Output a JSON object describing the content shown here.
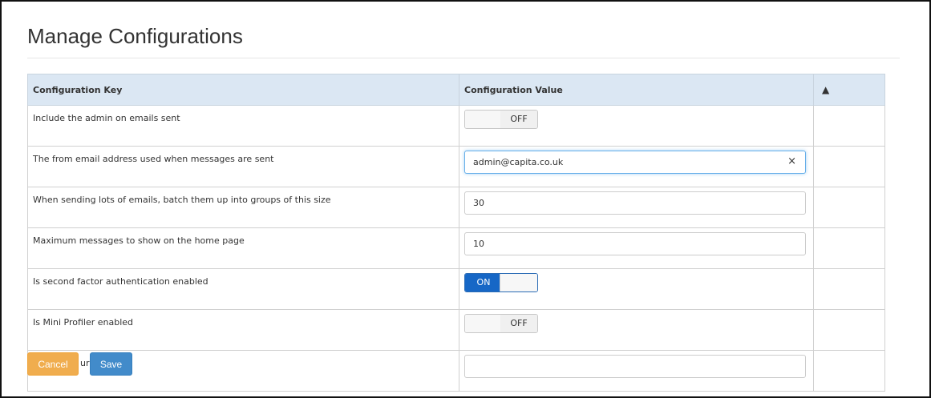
{
  "page": {
    "title": "Manage Configurations"
  },
  "table": {
    "headers": {
      "key": "Configuration Key",
      "value": "Configuration Value",
      "warning_icon": "warning-triangle-icon"
    },
    "rows": [
      {
        "key": "Include the admin on emails sent",
        "type": "toggle",
        "state": "OFF"
      },
      {
        "key": "The from email address used when messages are sent",
        "type": "text",
        "value": "admin@capita.co.uk",
        "clear_icon": "×"
      },
      {
        "key": "When sending lots of emails, batch them up into groups of this size",
        "type": "text",
        "value": "30"
      },
      {
        "key": "Maximum messages to show on the home page",
        "type": "text",
        "value": "10"
      },
      {
        "key": "Is second factor authentication enabled",
        "type": "toggle",
        "state": "ON"
      },
      {
        "key": "Is Mini Profiler enabled",
        "type": "toggle",
        "state": "OFF"
      },
      {
        "key": "The Portal url",
        "type": "text",
        "value": ""
      }
    ]
  },
  "buttons": {
    "cancel": "Cancel",
    "save": "Save"
  },
  "colors": {
    "header_bg": "#dbe7f3",
    "toggle_on": "#1667c6",
    "cancel": "#f0ad4e",
    "save": "#428bca"
  }
}
